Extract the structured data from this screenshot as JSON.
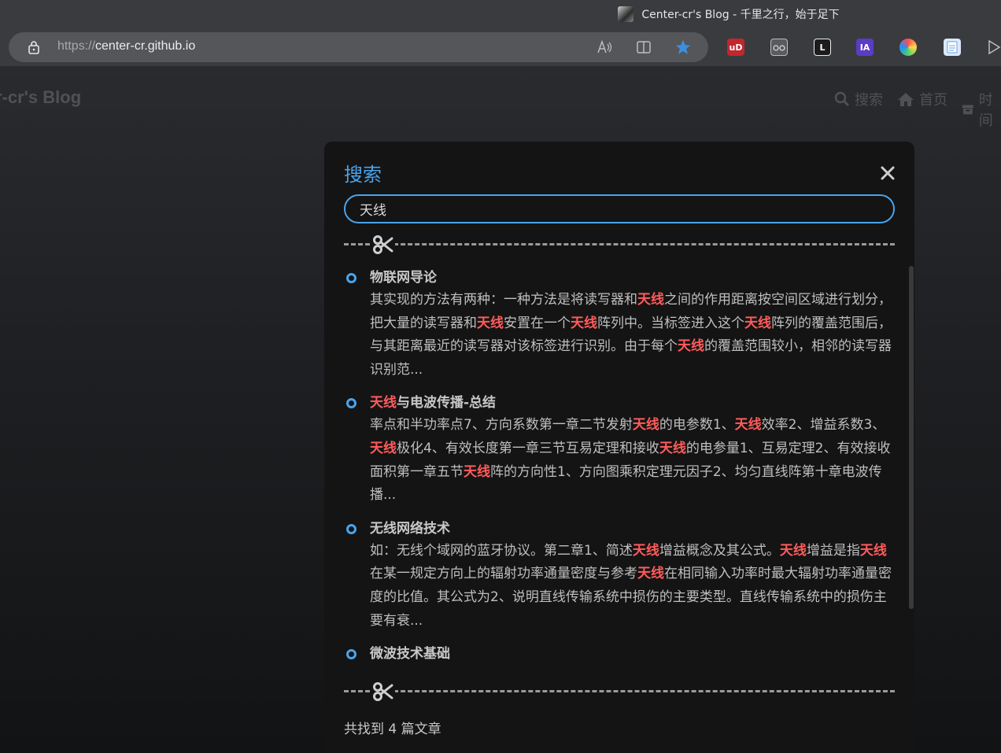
{
  "window": {
    "title": "Center-cr's Blog - 千里之行，始于足下"
  },
  "browser": {
    "url_scheme": "https://",
    "url_host": "center-cr.github.io",
    "toolbar_icons": [
      "read-aloud-icon",
      "split-screen-icon",
      "favorite-star-icon"
    ],
    "extensions": [
      {
        "name": "ublock-extension-icon",
        "label": "uD",
        "color": "#c1272d"
      },
      {
        "name": "glasses-extension-icon",
        "label": "",
        "color": "#5a5b5e"
      },
      {
        "name": "lastpass-extension-icon",
        "label": "L",
        "color": "#1c1c1c"
      },
      {
        "name": "ia-extension-icon",
        "label": "IA",
        "color": "#5b3cc4"
      },
      {
        "name": "color-wheel-extension-icon",
        "label": "",
        "color": "#1e90ff"
      },
      {
        "name": "document-extension-icon",
        "label": "",
        "color": "#dbe8fb"
      }
    ]
  },
  "site": {
    "brand": "r-cr's Blog",
    "nav": [
      {
        "icon": "search-icon",
        "label": "搜索"
      },
      {
        "icon": "home-icon",
        "label": "首页"
      },
      {
        "icon": "archive-icon",
        "label": "时间"
      }
    ]
  },
  "search_modal": {
    "title": "搜索",
    "query": "天线",
    "results": [
      {
        "title": [
          {
            "t": "物联网导论",
            "hl": false
          }
        ],
        "snippet": [
          {
            "t": "其实现的方法有两种：一种方法是将读写器和",
            "hl": false
          },
          {
            "t": "天线",
            "hl": true
          },
          {
            "t": "之间的作用距离按空间区域进行划分，把大量的读写器和",
            "hl": false
          },
          {
            "t": "天线",
            "hl": true
          },
          {
            "t": "安置在一个",
            "hl": false
          },
          {
            "t": "天线",
            "hl": true
          },
          {
            "t": "阵列中。当标签进入这个",
            "hl": false
          },
          {
            "t": "天线",
            "hl": true
          },
          {
            "t": "阵列的覆盖范围后，与其距离最近的读写器对该标签进行识别。由于每个",
            "hl": false
          },
          {
            "t": "天线",
            "hl": true
          },
          {
            "t": "的覆盖范围较小，相邻的读写器识别范...",
            "hl": false
          }
        ]
      },
      {
        "title": [
          {
            "t": "天线",
            "hl": true
          },
          {
            "t": "与电波传播-总结",
            "hl": false
          }
        ],
        "snippet": [
          {
            "t": "率点和半功率点7、方向系数第一章二节发射",
            "hl": false
          },
          {
            "t": "天线",
            "hl": true
          },
          {
            "t": "的电参数1、",
            "hl": false
          },
          {
            "t": "天线",
            "hl": true
          },
          {
            "t": "效率2、增益系数3、",
            "hl": false
          },
          {
            "t": "天线",
            "hl": true
          },
          {
            "t": "极化4、有效长度第一章三节互易定理和接收",
            "hl": false
          },
          {
            "t": "天线",
            "hl": true
          },
          {
            "t": "的电参量1、互易定理2、有效接收面积第一章五节",
            "hl": false
          },
          {
            "t": "天线",
            "hl": true
          },
          {
            "t": "阵的方向性1、方向图乘积定理元因子2、均匀直线阵第十章电波传播...",
            "hl": false
          }
        ]
      },
      {
        "title": [
          {
            "t": "无线网络技术",
            "hl": false
          }
        ],
        "snippet": [
          {
            "t": "如：无线个域网的蓝牙协议。第二章1、简述",
            "hl": false
          },
          {
            "t": "天线",
            "hl": true
          },
          {
            "t": "增益概念及其公式。",
            "hl": false
          },
          {
            "t": "天线",
            "hl": true
          },
          {
            "t": "增益是指",
            "hl": false
          },
          {
            "t": "天线",
            "hl": true
          },
          {
            "t": "在某一规定方向上的辐射功率通量密度与参考",
            "hl": false
          },
          {
            "t": "天线",
            "hl": true
          },
          {
            "t": "在相同输入功率时最大辐射功率通量密度的比值。其公式为2、说明直线传输系统中损伤的主要类型。直线传输系统中的损伤主要有衰...",
            "hl": false
          }
        ]
      },
      {
        "title": [
          {
            "t": "微波技术基础",
            "hl": false
          }
        ],
        "snippet": [
          {
            "t": "",
            "hl": false
          }
        ]
      }
    ],
    "count_text": "共找到 4 篇文章"
  }
}
